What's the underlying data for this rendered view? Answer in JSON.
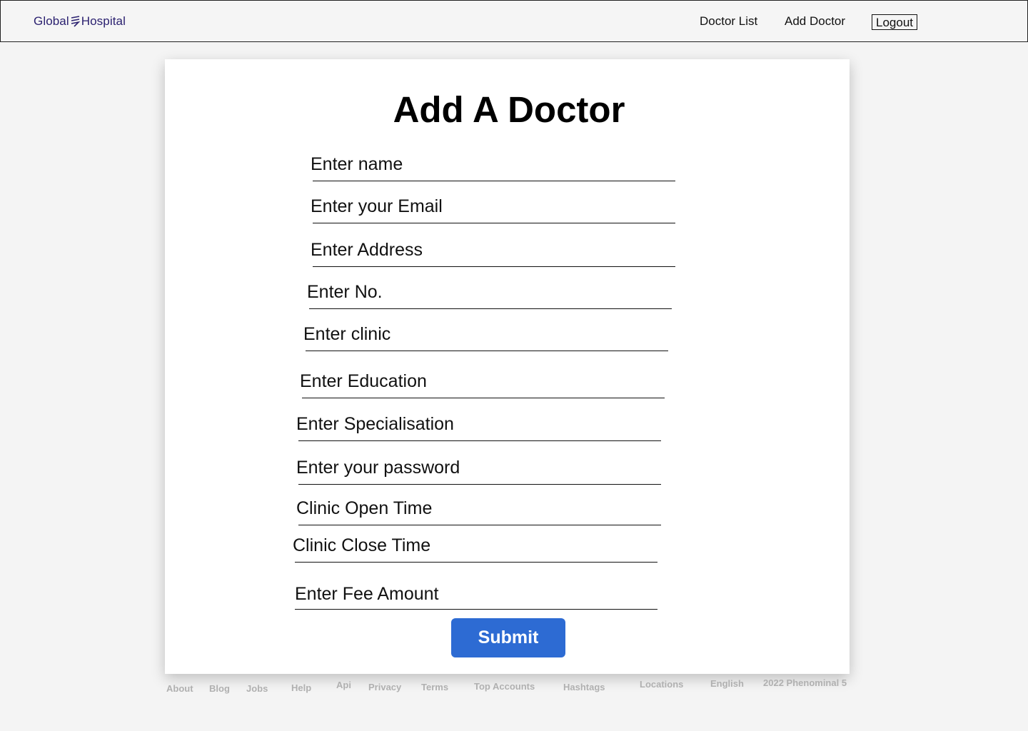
{
  "header": {
    "brand_left": "Global",
    "brand_right": "Hospital",
    "brand_mark_icon": "wave-lines-icon",
    "brand_color": "#2b2170",
    "nav": {
      "doctor_list": "Doctor List",
      "add_doctor": "Add Doctor",
      "logout": "Logout"
    }
  },
  "form": {
    "title": "Add A Doctor",
    "fields": [
      {
        "name": "name",
        "placeholder": "Enter name"
      },
      {
        "name": "email",
        "placeholder": "Enter your Email"
      },
      {
        "name": "address",
        "placeholder": "Enter Address"
      },
      {
        "name": "number",
        "placeholder": "Enter No."
      },
      {
        "name": "clinic",
        "placeholder": "Enter clinic"
      },
      {
        "name": "education",
        "placeholder": "Enter Education"
      },
      {
        "name": "specialisation",
        "placeholder": "Enter Specialisation"
      },
      {
        "name": "password",
        "placeholder": "Enter your password"
      },
      {
        "name": "open_time",
        "placeholder": "Clinic Open Time"
      },
      {
        "name": "close_time",
        "placeholder": "Clinic Close Time"
      },
      {
        "name": "fee",
        "placeholder": "Enter Fee Amount"
      }
    ],
    "submit_label": "Submit",
    "submit_color": "#2d6bd3"
  },
  "footer": {
    "links": [
      "About",
      "Blog",
      "Jobs",
      "Help",
      "Api",
      "Privacy",
      "Terms",
      "Top Accounts",
      "Hashtags",
      "Locations",
      "English"
    ],
    "copyright": "2022 Phenominal 5"
  }
}
